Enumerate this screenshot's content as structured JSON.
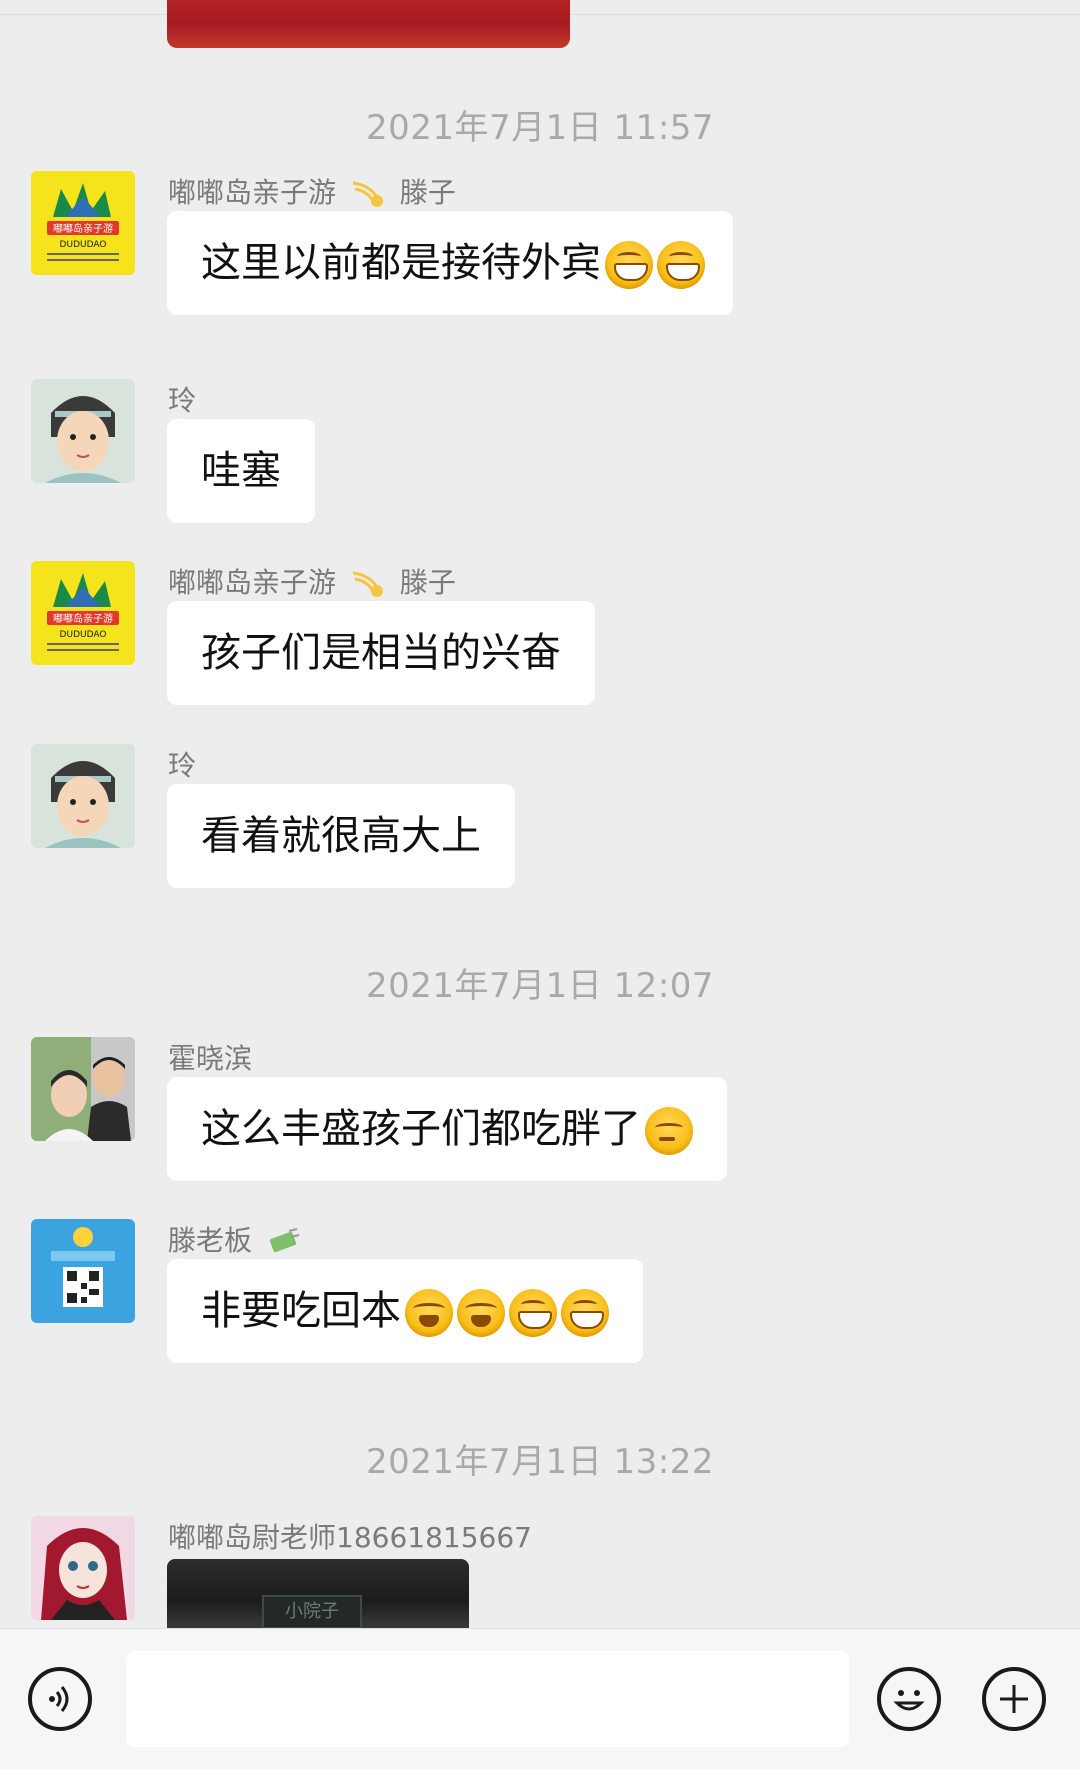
{
  "timestamps": [
    "2021年7月1日 11:57",
    "2021年7月1日 12:07",
    "2021年7月1日 13:22"
  ],
  "messages": [
    {
      "sender_prefix": "嘟嘟岛亲子游",
      "sender_suffix": "滕子",
      "text": "这里以前都是接待外宾",
      "emojis": [
        "grin",
        "grin"
      ]
    },
    {
      "sender_prefix": "玲",
      "sender_suffix": "",
      "text": "哇塞",
      "emojis": []
    },
    {
      "sender_prefix": "嘟嘟岛亲子游",
      "sender_suffix": "滕子",
      "text": "孩子们是相当的兴奋",
      "emojis": []
    },
    {
      "sender_prefix": "玲",
      "sender_suffix": "",
      "text": "看着就很高大上",
      "emojis": []
    },
    {
      "sender_prefix": "霍晓滨",
      "sender_suffix": "",
      "text": "这么丰盛孩子们都吃胖了",
      "emojis": [
        "think"
      ]
    },
    {
      "sender_prefix": "滕老板",
      "sender_suffix": "",
      "text": "非要吃回本",
      "emojis": [
        "cry",
        "cry",
        "grin",
        "grin"
      ]
    },
    {
      "sender_prefix": "嘟嘟岛尉老师18661815667",
      "sender_suffix": "",
      "text": "",
      "emojis": []
    }
  ],
  "avatars": {
    "dudu_logo_text": "嘟嘟岛亲子游",
    "dudu_logo_sub": "DUDUDAO"
  },
  "last_image_sign": "小院子",
  "input": {
    "placeholder": "",
    "value": ""
  },
  "icons": {
    "voice": "voice-icon",
    "emoji": "emoji-icon",
    "add": "add-icon"
  },
  "colors": {
    "background": "#ededed",
    "bubble": "#ffffff",
    "timestamp": "#a9a9a9",
    "sender": "#7a7a7a"
  }
}
